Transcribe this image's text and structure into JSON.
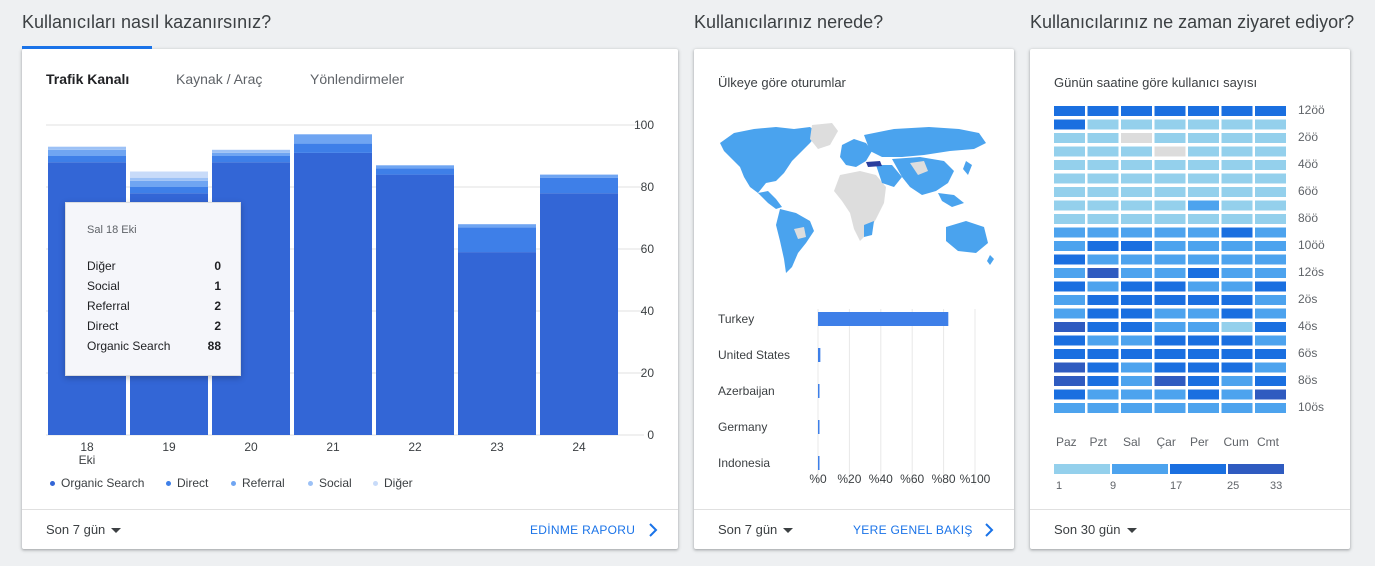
{
  "section_titles": {
    "acquisition": "Kullanıcıları nasıl kazanırsınız?",
    "location": "Kullanıcılarınız nerede?",
    "time": "Kullanıcılarınız ne zaman ziyaret ediyor?"
  },
  "acquisition_card": {
    "tabs": [
      "Trafik Kanalı",
      "Kaynak / Araç",
      "Yönlendirmeler"
    ],
    "active_tab": 0,
    "tooltip": {
      "date": "Sal 18 Eki",
      "rows": [
        {
          "label": "Diğer",
          "value": "0"
        },
        {
          "label": "Social",
          "value": "1"
        },
        {
          "label": "Referral",
          "value": "2"
        },
        {
          "label": "Direct",
          "value": "2"
        },
        {
          "label": "Organic Search",
          "value": "88"
        }
      ]
    },
    "legend": [
      {
        "label": "Organic Search",
        "color": "#3366d6"
      },
      {
        "label": "Direct",
        "color": "#3e7fe8"
      },
      {
        "label": "Referral",
        "color": "#6fa5f2"
      },
      {
        "label": "Social",
        "color": "#9cc1f6"
      },
      {
        "label": "Diğer",
        "color": "#c8dbf9"
      }
    ],
    "period": "Son 7 gün",
    "link": "EDİNME RAPORU"
  },
  "location_card": {
    "title": "Ülkeye göre oturumlar",
    "period": "Son 7 gün",
    "link": "YERE GENEL BAKIŞ"
  },
  "time_card": {
    "title": "Günün saatine göre kullanıcı sayısı",
    "days": [
      "Paz",
      "Pzt",
      "Sal",
      "Çar",
      "Per",
      "Cum",
      "Cmt"
    ],
    "hours": [
      "12öö",
      "2öö",
      "4öö",
      "6öö",
      "8öö",
      "10öö",
      "12ös",
      "2ös",
      "4ös",
      "6ös",
      "8ös",
      "10ös"
    ],
    "scale_labels": [
      "1",
      "9",
      "17",
      "25",
      "33"
    ],
    "scale_colors": [
      "#94d0ec",
      "#4da3ee",
      "#1a6fe0",
      "#2f5bc0"
    ],
    "empty_color": "#dcdcdc",
    "period": "Son 30 gün",
    "heatmap": [
      [
        3,
        3,
        3,
        3,
        3,
        3,
        3
      ],
      [
        3,
        1,
        1,
        1,
        1,
        1,
        1
      ],
      [
        1,
        1,
        0,
        1,
        1,
        1,
        1
      ],
      [
        1,
        1,
        1,
        0,
        1,
        1,
        1
      ],
      [
        1,
        1,
        1,
        1,
        1,
        1,
        1
      ],
      [
        1,
        1,
        1,
        1,
        1,
        1,
        1
      ],
      [
        1,
        1,
        1,
        1,
        1,
        1,
        1
      ],
      [
        1,
        1,
        1,
        1,
        2,
        1,
        1
      ],
      [
        1,
        1,
        1,
        1,
        1,
        1,
        1
      ],
      [
        2,
        2,
        2,
        2,
        2,
        3,
        2
      ],
      [
        2,
        3,
        3,
        2,
        2,
        2,
        2
      ],
      [
        3,
        2,
        2,
        2,
        2,
        2,
        2
      ],
      [
        2,
        4,
        2,
        2,
        3,
        2,
        2
      ],
      [
        3,
        2,
        3,
        3,
        2,
        2,
        3
      ],
      [
        2,
        3,
        3,
        3,
        3,
        3,
        2
      ],
      [
        2,
        3,
        3,
        2,
        2,
        3,
        2
      ],
      [
        4,
        3,
        3,
        2,
        2,
        1,
        3
      ],
      [
        3,
        2,
        2,
        3,
        3,
        3,
        2
      ],
      [
        3,
        3,
        3,
        3,
        3,
        3,
        3
      ],
      [
        4,
        3,
        2,
        3,
        3,
        3,
        2
      ],
      [
        4,
        3,
        2,
        4,
        3,
        2,
        3
      ],
      [
        3,
        2,
        2,
        2,
        3,
        2,
        4
      ],
      [
        2,
        2,
        2,
        2,
        2,
        2,
        2
      ]
    ]
  },
  "chart_data": [
    {
      "type": "bar",
      "stacked": true,
      "categories": [
        "18",
        "19",
        "20",
        "21",
        "22",
        "23",
        "24"
      ],
      "category_sublabels": [
        "Eki",
        "",
        "",
        "",
        "",
        "",
        ""
      ],
      "ylim": [
        0,
        100
      ],
      "yticks": [
        0,
        20,
        40,
        60,
        80,
        100
      ],
      "series": [
        {
          "name": "Organic Search",
          "color": "#3366d6",
          "values": [
            88,
            78,
            88,
            91,
            84,
            59,
            78
          ]
        },
        {
          "name": "Direct",
          "color": "#3e7fe8",
          "values": [
            2,
            2,
            2,
            3,
            2,
            8,
            5
          ]
        },
        {
          "name": "Referral",
          "color": "#6fa5f2",
          "values": [
            2,
            2,
            1,
            3,
            1,
            1,
            1
          ]
        },
        {
          "name": "Social",
          "color": "#9cc1f6",
          "values": [
            1,
            1,
            1,
            0,
            0,
            0,
            0
          ]
        },
        {
          "name": "Diğer",
          "color": "#c8dbf9",
          "values": [
            0,
            2,
            0,
            0,
            0,
            0,
            0
          ]
        }
      ]
    },
    {
      "type": "bar",
      "orientation": "horizontal",
      "categories": [
        "Turkey",
        "United States",
        "Azerbaijan",
        "Germany",
        "Indonesia"
      ],
      "values": [
        83,
        1.5,
        0.8,
        0.5,
        0.3
      ],
      "xlim": [
        0,
        100
      ],
      "xtick_labels": [
        "%0",
        "%20",
        "%40",
        "%60",
        "%80",
        "%100"
      ],
      "color": "#3e7fe8"
    }
  ]
}
